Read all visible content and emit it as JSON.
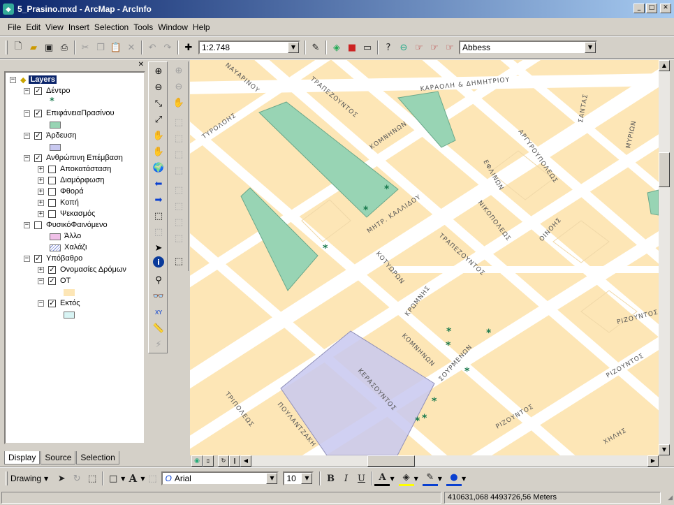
{
  "window": {
    "title": "5_Prasino.mxd - ArcMap - ArcInfo"
  },
  "menu": [
    "File",
    "Edit",
    "View",
    "Insert",
    "Selection",
    "Tools",
    "Window",
    "Help"
  ],
  "toolbar": {
    "scale": "1:2.748",
    "layer_select": "Abbess"
  },
  "toc": {
    "root": "Layers",
    "layers": [
      {
        "name": "Δέντρο"
      },
      {
        "name": "ΕπιφάνειαΠρασίνου"
      },
      {
        "name": "Άρδευση"
      },
      {
        "name": "Ανθρώπινη Επέμβαση",
        "children": [
          "Αποκατάσταση",
          "Διαμόρφωση",
          "Φθορά",
          "Κοπή",
          "Ψεκασμός"
        ]
      },
      {
        "name": "ΦυσικόΦαινόμενο",
        "children": [
          "Άλλο",
          "Χαλάζι"
        ]
      },
      {
        "name": "Υπόβαθρο",
        "children": [
          "Ονομασίες Δρόμων",
          "ΟΤ",
          "Εκτός"
        ]
      }
    ],
    "tabs": [
      "Display",
      "Source",
      "Selection"
    ]
  },
  "colors": {
    "block": "#fde6b6",
    "green": "#98d4b4",
    "selection": "#c8c8f0",
    "tree": "#1a7a4e"
  },
  "streets": [
    "ΝΑΥΑΡΙΝΟΥ",
    "ΤΡΑΠΕΖΟΥΝΤΟΣ",
    "ΚΑΡΑΟΛΗ & ΔΗΜΗΤΡΙΟΥ",
    "ΤΥΡΟΛΟΗΣ",
    "ΚΟΜΝΗΝΩΝ",
    "ΣΑΝΤΑΣ",
    "ΑΡΓΥΡΟΥΠΟΛΕΩΣ",
    "ΜΥΡΙΩΝ",
    "ΜΗΤΡ. ΚΑΛΛΙΔΟΥ",
    "ΕΦΛΙΝΩΝ",
    "ΝΙΚΟΠΟΛΕΩΣ",
    "ΟΙΝΟΗΣ",
    "ΚΟΤΥΩΡΩΝ",
    "ΤΡΑΠΕΖΟΥΝΤΟΣ",
    "ΚΡΩΜΝΗΣ",
    "ΚΟΜΝΗΝΩΝ",
    "ΣΟΥΡΜΕΝΩΝ",
    "ΚΕΡΑΣΟΥΝΤΟΣ",
    "ΠΟΥΛΑΝΤΖΑΚΗ",
    "ΤΡΙΠΟΛΕΩΣ",
    "ΡΙΖΟΥΝΤΟΣ",
    "ΡΙΖΟΥΝΤΟΣ",
    "ΡΙΖΟΥΝΤΟΣ",
    "ΧΗΛΗΣ"
  ],
  "drawing": {
    "label": "Drawing",
    "font": "Arial",
    "size": "10"
  },
  "status": {
    "coords": "410631,068  4493726,56 Meters"
  }
}
